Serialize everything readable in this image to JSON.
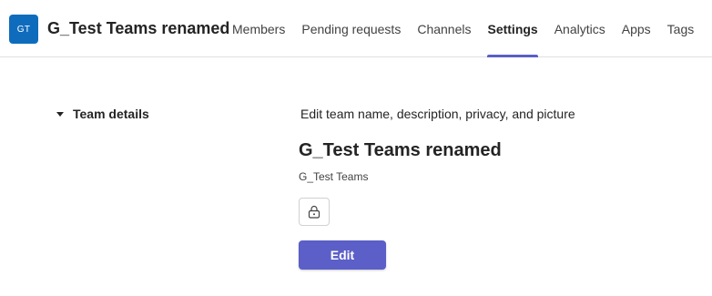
{
  "header": {
    "avatar_initials": "GT",
    "team_name": "G_Test Teams renamed",
    "tabs": [
      {
        "label": "Members",
        "active": false
      },
      {
        "label": "Pending requests",
        "active": false
      },
      {
        "label": "Channels",
        "active": false
      },
      {
        "label": "Settings",
        "active": true
      },
      {
        "label": "Analytics",
        "active": false
      },
      {
        "label": "Apps",
        "active": false
      },
      {
        "label": "Tags",
        "active": false
      }
    ]
  },
  "settings": {
    "section_label": "Team details",
    "description": "Edit team name, description, privacy, and picture",
    "team_display_name": "G_Test Teams renamed",
    "team_subtitle": "G_Test Teams",
    "privacy_icon": "lock-icon",
    "edit_label": "Edit"
  },
  "colors": {
    "avatar_bg": "#0f6cbd",
    "accent": "#5b5fc7",
    "divider": "#e0e0e0"
  }
}
